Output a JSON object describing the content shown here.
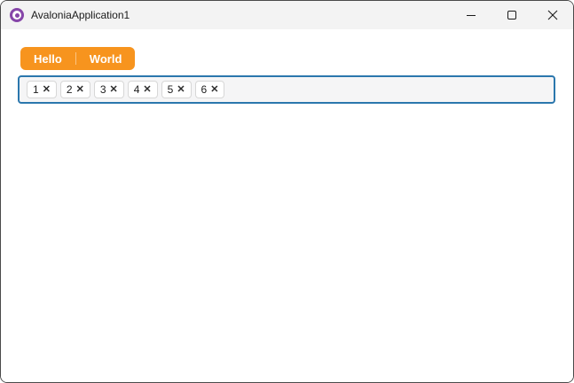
{
  "window": {
    "title": "AvaloniaApplication1",
    "controls": {
      "minimize_icon": "minimize-line",
      "maximize_icon": "square-outline",
      "close_icon": "x-cross"
    },
    "app_icon": "avalonia-purple-donut-logo"
  },
  "tabs": [
    {
      "label": "Hello"
    },
    {
      "label": "World"
    }
  ],
  "tag_box": {
    "items": [
      {
        "label": "1"
      },
      {
        "label": "2"
      },
      {
        "label": "3"
      },
      {
        "label": "4"
      },
      {
        "label": "5"
      },
      {
        "label": "6"
      }
    ]
  },
  "icons": {
    "chip_close": "✕"
  },
  "colors": {
    "accent_orange": "#F7941E",
    "focus_blue": "#2B77AD",
    "logo_purple": "#8646A9"
  }
}
